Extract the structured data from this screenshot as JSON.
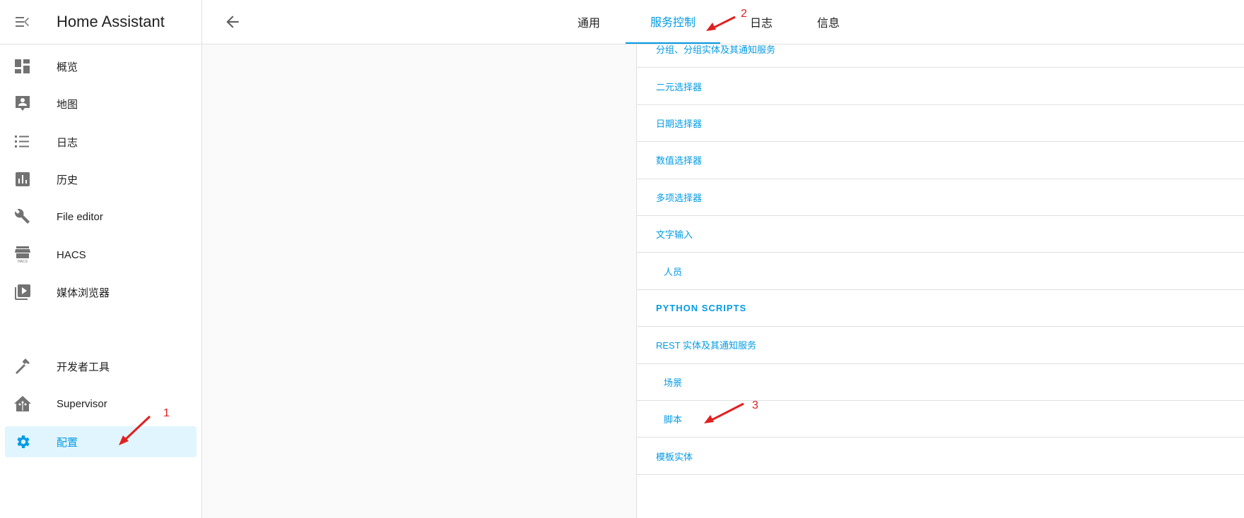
{
  "sidebar": {
    "title": "Home Assistant",
    "items": [
      {
        "label": "概览",
        "icon": "dashboard-icon"
      },
      {
        "label": "地图",
        "icon": "map-account-icon"
      },
      {
        "label": "日志",
        "icon": "logbook-list-icon"
      },
      {
        "label": "历史",
        "icon": "history-chart-icon"
      },
      {
        "label": "File editor",
        "icon": "wrench-icon"
      },
      {
        "label": "HACS",
        "icon": "hacs-store-icon"
      },
      {
        "label": "媒体浏览器",
        "icon": "media-play-box-icon"
      },
      {
        "label": "开发者工具",
        "icon": "hammer-icon"
      },
      {
        "label": "Supervisor",
        "icon": "home-assistant-icon"
      },
      {
        "label": "配置",
        "icon": "gear-icon",
        "selected": true
      }
    ]
  },
  "header": {
    "tabs": [
      "通用",
      "服务控制",
      "日志",
      "信息"
    ],
    "active_tab": 1
  },
  "list": [
    "分组、分组实体及其通知服务",
    "二元选择器",
    "日期选择器",
    "数值选择器",
    "多项选择器",
    "文字输入",
    "人员",
    "PYTHON SCRIPTS",
    "REST 实体及其通知服务",
    "场景",
    "脚本",
    "模板实体"
  ],
  "annotations": [
    "1",
    "2",
    "3"
  ],
  "colors": {
    "accent": "#039be5",
    "icon": "#727272",
    "annotation": "#e02020"
  }
}
